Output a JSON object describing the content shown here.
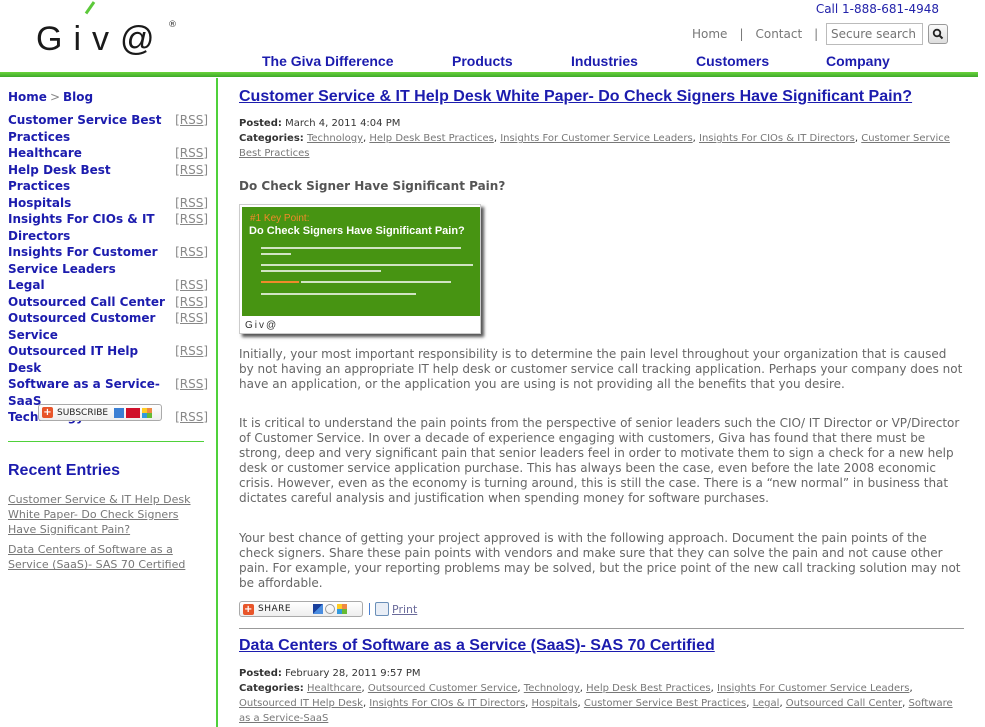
{
  "header": {
    "logo_text": "Giv@",
    "logo_reg": "®",
    "call": "Call 1-888-681-4948",
    "top_links": [
      "Home",
      "Contact"
    ],
    "search_placeholder": "Secure search",
    "search_icon": "magnifier-icon",
    "nav": [
      "The Giva Difference",
      "Products",
      "Industries",
      "Customers",
      "Company"
    ]
  },
  "colors": {
    "brand_green": "#4fd13a",
    "link_blue": "#1c1cae",
    "figure_green": "#479412",
    "accent_orange": "#f08a2a"
  },
  "sidebar": {
    "breadcrumb": [
      "Home",
      "Blog"
    ],
    "breadcrumb_sep": ">",
    "rss_label": "[RSS]",
    "categories": [
      "Customer Service Best Practices",
      "Healthcare",
      "Help Desk Best Practices",
      "Hospitals",
      "Insights For CIOs & IT Directors",
      "Insights For Customer Service Leaders",
      "Legal",
      "Outsourced Call Center",
      "Outsourced Customer Service",
      "Outsourced IT Help Desk",
      "Software as a Service-SaaS",
      "Technology"
    ],
    "subscribe_label": "SUBSCRIBE",
    "recent_heading": "Recent Entries",
    "recent_entries": [
      "Customer Service & IT Help Desk White Paper- Do Check Signers Have Significant Pain?",
      "Data Centers of Software as a Service (SaaS)- SAS 70 Certified"
    ]
  },
  "posts": [
    {
      "title": "Customer Service & IT Help Desk White Paper- Do Check Signers Have Significant Pain?",
      "posted_label": "Posted:",
      "posted": "March 4, 2011 4:04 PM",
      "categories_label": "Categories:",
      "categories": [
        "Technology",
        "Help Desk Best Practices",
        "Insights For Customer Service Leaders",
        "Insights For CIOs & IT Directors",
        "Customer Service Best Practices"
      ],
      "subheading": "Do Check Signer Have Significant Pain?",
      "figure": {
        "key_point": "#1 Key Point:",
        "title": "Do Check Signers Have Significant Pain?",
        "logo": "Giv@"
      },
      "paragraphs": [
        "Initially, your most important responsibility is to determine the pain level throughout your organization that is caused by not having an appropriate IT help desk or customer service call tracking application. Perhaps your company does not have an application, or the application you are using is not providing all the benefits that you desire.",
        "It is critical to understand the pain points from the perspective of senior leaders such the CIO/ IT Director or VP/Director of Customer Service. In over a decade of experience engaging with customers, Giva has found that there must be strong, deep and very significant pain that senior leaders feel in order to motivate them to sign a check for a new help desk or customer service application purchase. This has always been the case, even before the late 2008 economic crisis. However, even as the economy is turning around, this is still the case. There is a “new normal” in business that dictates careful analysis and justification when spending money for software purchases.",
        "Your best chance of getting your project approved is with the following approach. Document the pain points of the check signers. Share these pain points with vendors and make sure that they can solve the pain and not cause other pain. For example, your reporting problems may be solved, but the price point of the new call tracking solution may not be affordable."
      ],
      "share_label": "SHARE",
      "print_label": "Print"
    },
    {
      "title": "Data Centers of Software as a Service (SaaS)- SAS 70 Certified",
      "posted_label": "Posted:",
      "posted": "February 28, 2011 9:57 PM",
      "categories_label": "Categories:",
      "categories": [
        "Healthcare",
        "Outsourced Customer Service",
        "Technology",
        "Help Desk Best Practices",
        "Insights For Customer Service Leaders",
        "Outsourced IT Help Desk",
        "Insights For CIOs & IT Directors",
        "Hospitals",
        "Customer Service Best Practices",
        "Legal",
        "Outsourced Call Center",
        "Software as a Service-SaaS"
      ]
    }
  ]
}
